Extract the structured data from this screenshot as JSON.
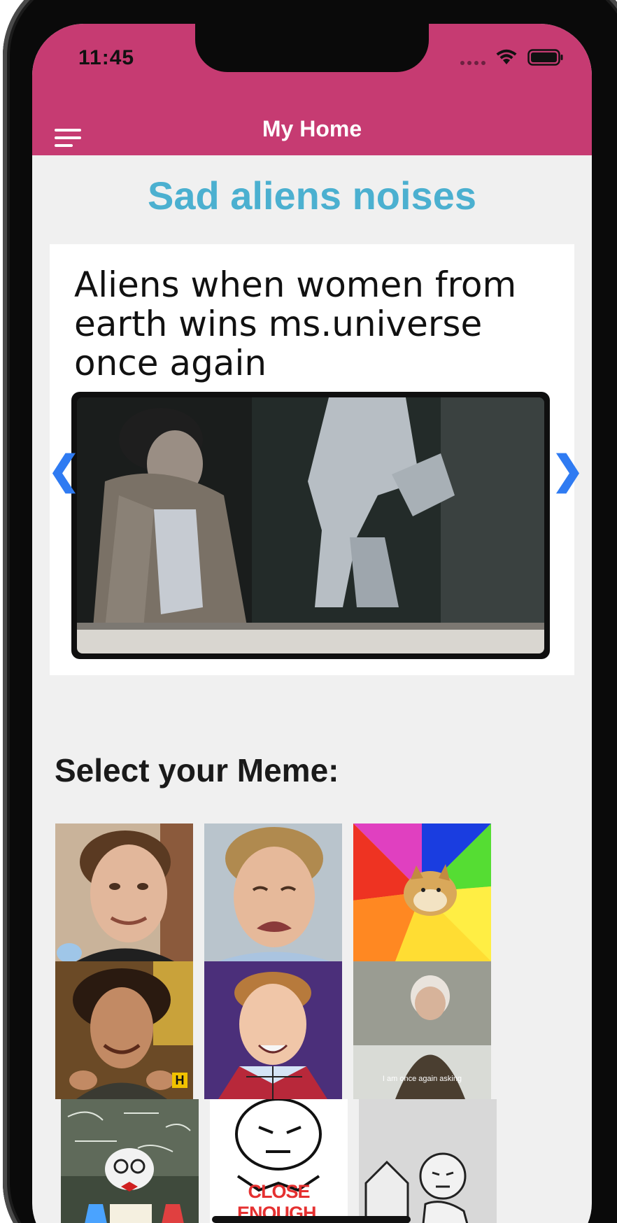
{
  "status": {
    "time": "11:45"
  },
  "navbar": {
    "title": "My Home"
  },
  "meme": {
    "title": "Sad aliens noises",
    "caption": "Aliens when women from earth wins ms.universe once again"
  },
  "carousel": {
    "prev_arrow": "❮",
    "next_arrow": "❯"
  },
  "selector": {
    "label": "Select your Meme:",
    "tiles": [
      {
        "name": "10-guy"
      },
      {
        "name": "crying-dawson"
      },
      {
        "name": "doge"
      },
      {
        "name": "ancient-aliens",
        "badge": "H"
      },
      {
        "name": "bad-luck-brian"
      },
      {
        "name": "bernie-asking",
        "text": "I am once again asking"
      },
      {
        "name": "scientist-cat"
      },
      {
        "name": "close-enough",
        "text": "CLOSE ENOUGH."
      },
      {
        "name": "computer-guy"
      }
    ]
  },
  "colors": {
    "header": "#c63b72",
    "title": "#4bb0d0",
    "arrow": "#2f7bf2",
    "screen_bg": "#f0f0f0"
  }
}
